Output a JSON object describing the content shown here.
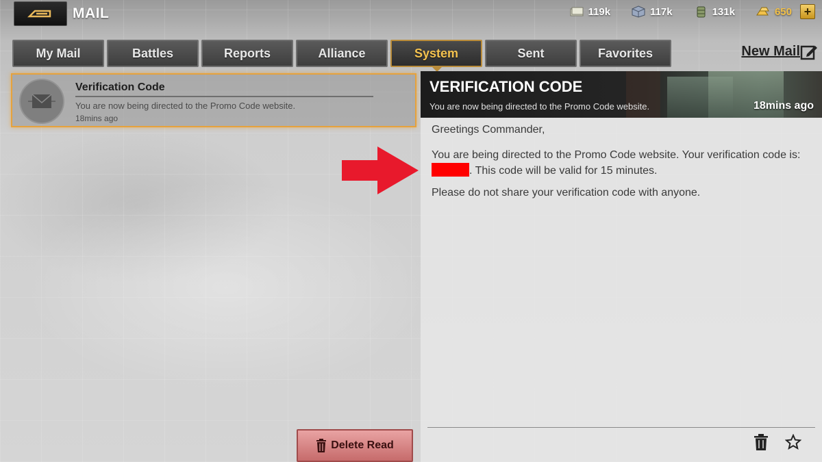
{
  "header": {
    "title": "MAIL",
    "back_icon": "back-arrow-icon"
  },
  "resources": [
    {
      "name": "cash",
      "icon": "cash-icon",
      "value": "119k"
    },
    {
      "name": "steel",
      "icon": "steel-cube-icon",
      "value": "117k"
    },
    {
      "name": "oil",
      "icon": "oil-barrel-icon",
      "value": "131k"
    },
    {
      "name": "gold",
      "icon": "gold-bars-icon",
      "value": "650"
    }
  ],
  "plus_label": "+",
  "tabs": [
    {
      "label": "My Mail"
    },
    {
      "label": "Battles"
    },
    {
      "label": "Reports"
    },
    {
      "label": "Alliance"
    },
    {
      "label": "System",
      "active": true
    },
    {
      "label": "Sent"
    },
    {
      "label": "Favorites"
    }
  ],
  "new_mail_label": "New Mail",
  "mail_list": [
    {
      "subject": "Verification Code",
      "preview": "You are now being directed to the Promo Code website.",
      "time": "18mins ago",
      "selected": true
    }
  ],
  "delete_read_label": "Delete Read",
  "reader": {
    "title": "VERIFICATION CODE",
    "subtitle": "You are now being directed to the Promo Code website.",
    "time": "18mins ago",
    "greeting": "Greetings Commander,",
    "line1": "You are being directed to the Promo Code website. Your verification code is:",
    "line2_suffix": ". This code will be valid for 15 minutes.",
    "line3": "Please do not share your verification code with anyone."
  },
  "colors": {
    "accent_gold": "#f4c24f",
    "selection_border": "#e6a23c",
    "redaction": "#ff0000",
    "annotation_arrow": "#e8192c"
  }
}
